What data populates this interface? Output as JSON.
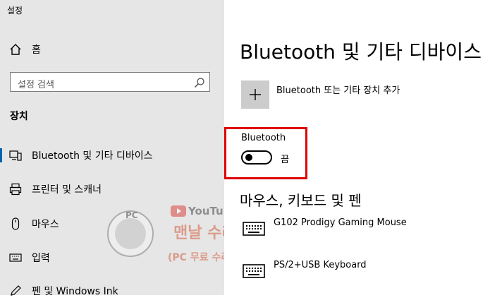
{
  "app": {
    "title": "설정"
  },
  "sidebar": {
    "home": {
      "label": "홈",
      "icon": "home-icon"
    },
    "search": {
      "placeholder": "설정 검색",
      "icon": "search-icon"
    },
    "section": "장치",
    "items": [
      {
        "label": "Bluetooth 및 기타 디바이스",
        "icon": "bluetooth-devices-icon",
        "selected": true
      },
      {
        "label": "프린터 및 스캐너",
        "icon": "printer-icon",
        "selected": false
      },
      {
        "label": "마우스",
        "icon": "mouse-icon",
        "selected": false
      },
      {
        "label": "입력",
        "icon": "keyboard-icon",
        "selected": false
      },
      {
        "label": "펜 및 Windows Ink",
        "icon": "pen-icon",
        "selected": false
      }
    ]
  },
  "main": {
    "title": "Bluetooth 및 기타 디바이스",
    "add_device_label": "Bluetooth 또는 기타 장치 추가",
    "bluetooth": {
      "label": "Bluetooth",
      "state": "끔",
      "on": false
    },
    "peripherals_header": "마우스, 키보드 및 펜",
    "devices": [
      {
        "name": "G102 Prodigy Gaming Mouse",
        "icon": "keyboard-icon"
      },
      {
        "name": "PS/2+USB Keyboard",
        "icon": "keyboard-icon"
      }
    ]
  },
  "watermark": {
    "logo_text": "PC",
    "youtube": "YouTube",
    "line1": "맨날 수리야",
    "line2": "(PC 무료 수리, 꿀팁)"
  },
  "colors": {
    "sidebar_bg": "#e6e6e6",
    "accent": "#0063b1",
    "highlight": "#e00000",
    "add_button_bg": "#cccccc"
  }
}
